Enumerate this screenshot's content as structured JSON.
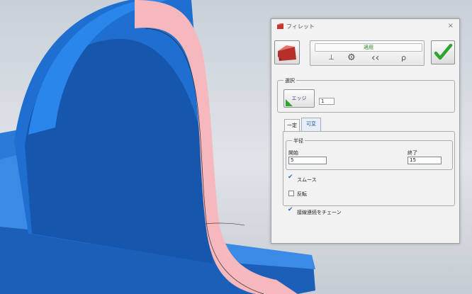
{
  "dialog": {
    "title": "フィレット",
    "close_symbol": "×",
    "toolbar": {
      "apply_label": "適用",
      "icons": [
        "draft-icon",
        "settings-gear-icon",
        "back-double-chevron-icon",
        "pin-icon"
      ]
    },
    "selection_group": {
      "title": "選択",
      "edge_button_label": "エッジ",
      "count": "1"
    },
    "tabs": [
      {
        "label": "一定",
        "active": true
      },
      {
        "label": "可変",
        "active": false
      }
    ],
    "radius_group": {
      "title": "半径",
      "start_label": "開始",
      "start_value": "5",
      "end_label": "終了",
      "end_value": "15"
    },
    "smooth": {
      "label": "スムース",
      "checked": true
    },
    "reverse": {
      "label": "反転",
      "checked": false
    },
    "chain": {
      "label": "接線連続をチェーン",
      "checked": true
    }
  },
  "colors": {
    "part_blue": "#1e6fd0",
    "fillet_pink": "#f6b7bd",
    "ok_green": "#2fa52f"
  }
}
